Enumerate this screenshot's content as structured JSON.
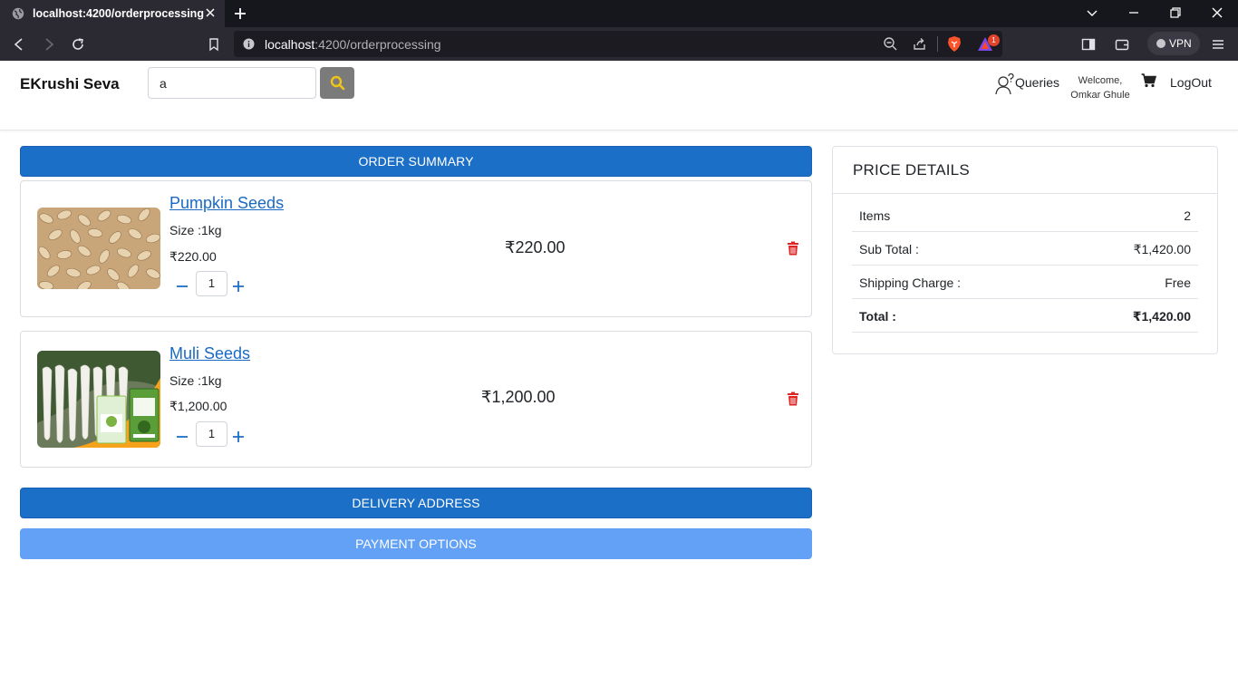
{
  "browser": {
    "tab_title": "localhost:4200/orderprocessing",
    "url_host": "localhost",
    "url_rest": ":4200/orderprocessing",
    "vpn_label": "VPN",
    "notification_count": "1"
  },
  "header": {
    "brand": "EKrushi Seva",
    "search_value": "a",
    "queries_label": "Queries",
    "welcome_line1": "Welcome,",
    "welcome_line2": "Omkar Ghule",
    "logout_label": "LogOut"
  },
  "order_summary": {
    "label": "ORDER SUMMARY",
    "items": [
      {
        "name": "Pumpkin Seeds",
        "size": "Size :1kg",
        "unit_price": "₹220.00",
        "quantity": "1",
        "line_total": "₹220.00"
      },
      {
        "name": "Muli Seeds",
        "size": "Size :1kg",
        "unit_price": "₹1,200.00",
        "quantity": "1",
        "line_total": "₹1,200.00"
      }
    ]
  },
  "delivery": {
    "label": "DELIVERY ADDRESS"
  },
  "payment": {
    "label": "PAYMENT OPTIONS"
  },
  "price_details": {
    "title": "PRICE DETAILS",
    "rows": [
      {
        "label": "Items",
        "value": "2"
      },
      {
        "label": "Sub Total :",
        "value": "₹1,420.00"
      },
      {
        "label": "Shipping Charge :",
        "value": "Free"
      },
      {
        "label": "Total :",
        "value": "₹1,420.00"
      }
    ]
  },
  "colors": {
    "primary": "#1c6fc6",
    "primary_light": "#62a1f6",
    "link": "#1a6ac4",
    "delete": "#e02424",
    "search_icon": "#f0c419"
  }
}
